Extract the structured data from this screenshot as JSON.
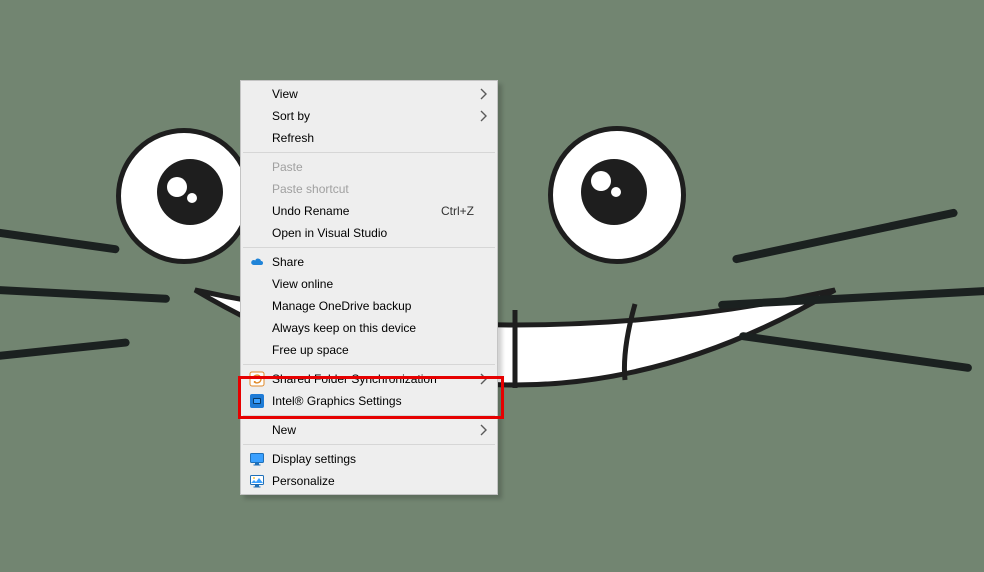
{
  "context_menu": {
    "items": [
      {
        "id": "view",
        "label": "View",
        "submenu": true,
        "icon": "none"
      },
      {
        "id": "sortby",
        "label": "Sort by",
        "submenu": true,
        "icon": "none"
      },
      {
        "id": "refresh",
        "label": "Refresh",
        "icon": "none"
      },
      {
        "sep": true
      },
      {
        "id": "paste",
        "label": "Paste",
        "disabled": true,
        "icon": "none"
      },
      {
        "id": "paste-shortcut",
        "label": "Paste shortcut",
        "disabled": true,
        "icon": "none"
      },
      {
        "id": "undo-rename",
        "label": "Undo Rename",
        "shortcut": "Ctrl+Z",
        "icon": "none"
      },
      {
        "id": "open-vs",
        "label": "Open in Visual Studio",
        "icon": "none"
      },
      {
        "sep": true
      },
      {
        "id": "share",
        "label": "Share",
        "icon": "cloud"
      },
      {
        "id": "view-online",
        "label": "View online",
        "icon": "none"
      },
      {
        "id": "manage-onedrive-backup",
        "label": "Manage OneDrive backup",
        "icon": "none"
      },
      {
        "id": "always-keep-device",
        "label": "Always keep on this device",
        "icon": "none"
      },
      {
        "id": "free-up-space",
        "label": "Free up space",
        "icon": "none"
      },
      {
        "sep": true
      },
      {
        "id": "shared-folder-sync",
        "label": "Shared Folder Synchronization",
        "submenu": true,
        "icon": "sync"
      },
      {
        "id": "intel-graphics-settings",
        "label": "Intel® Graphics Settings",
        "icon": "intel"
      },
      {
        "sep": true
      },
      {
        "id": "new",
        "label": "New",
        "submenu": true,
        "icon": "none"
      },
      {
        "sep": true
      },
      {
        "id": "display-settings",
        "label": "Display settings",
        "icon": "display"
      },
      {
        "id": "personalize",
        "label": "Personalize",
        "icon": "personalize"
      }
    ]
  },
  "annotation": {
    "highlight_target": "intel-graphics-settings"
  }
}
